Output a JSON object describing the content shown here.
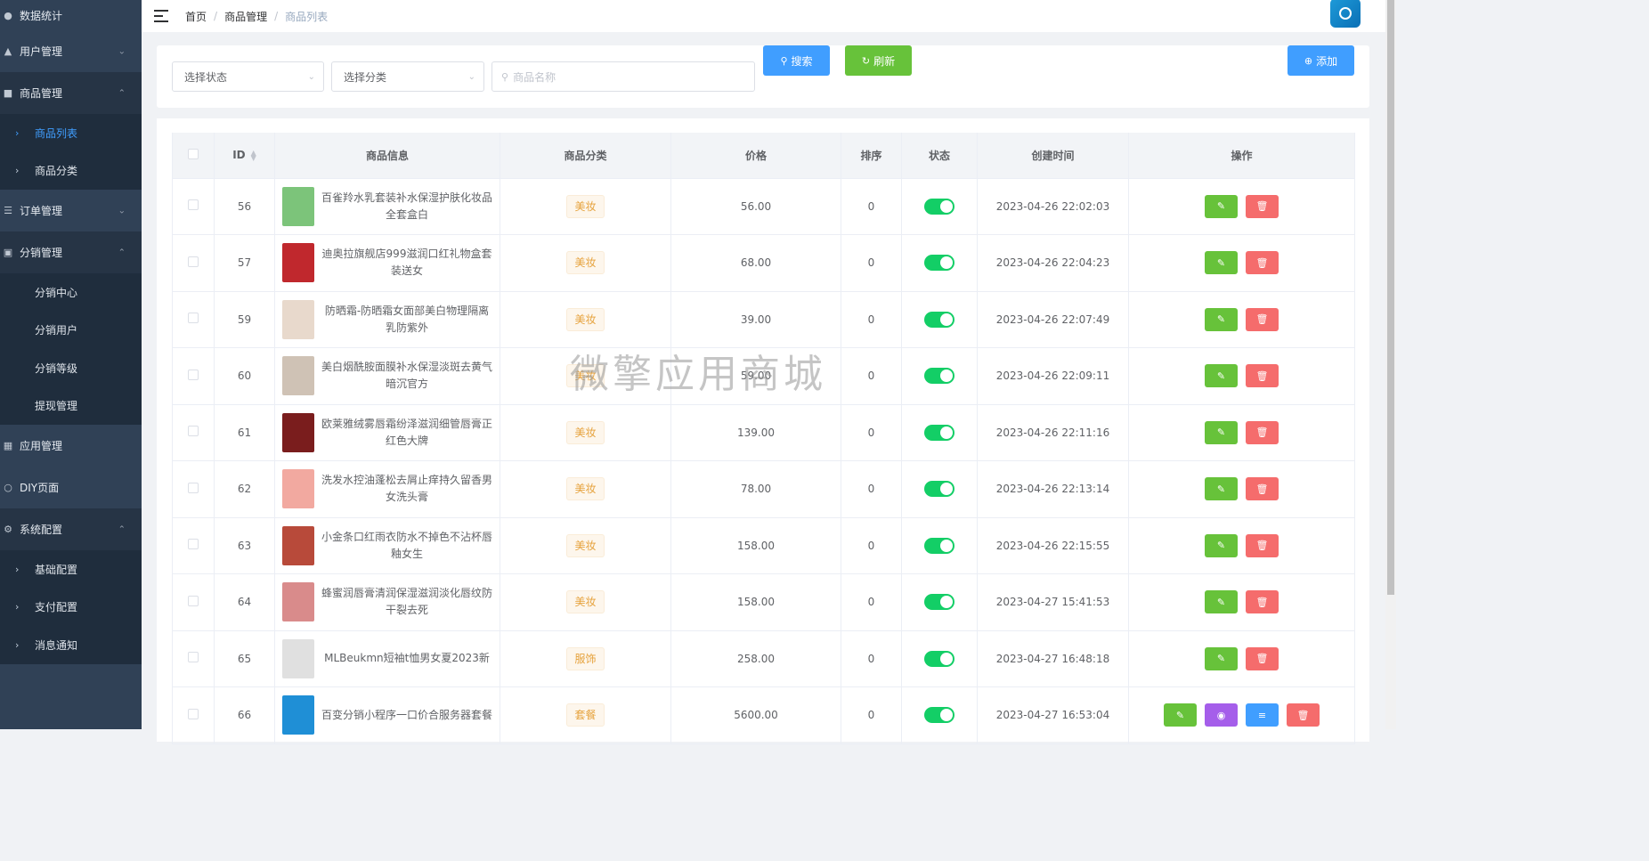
{
  "sidebar": {
    "items": [
      {
        "label": "数据统计",
        "icon": "dashboard-icon"
      },
      {
        "label": "用户管理",
        "icon": "user-icon",
        "arrow": "down"
      },
      {
        "label": "商品管理",
        "icon": "goods-icon",
        "arrow": "up"
      },
      {
        "label": "订单管理",
        "icon": "order-icon",
        "arrow": "down"
      },
      {
        "label": "分销管理",
        "icon": "distribution-icon",
        "arrow": "up"
      },
      {
        "label": "应用管理",
        "icon": "apps-icon"
      },
      {
        "label": "DIY页面",
        "icon": "diy-icon"
      },
      {
        "label": "系统配置",
        "icon": "settings-icon",
        "arrow": "up"
      }
    ],
    "goods_sub": [
      "商品列表",
      "商品分类"
    ],
    "distribution_sub": [
      "分销中心",
      "分销用户",
      "分销等级",
      "提现管理"
    ],
    "settings_sub": [
      "基础配置",
      "支付配置",
      "消息通知"
    ]
  },
  "breadcrumb": [
    "首页",
    "商品管理",
    "商品列表"
  ],
  "filters": {
    "status_placeholder": "选择状态",
    "category_placeholder": "选择分类",
    "name_placeholder": "商品名称",
    "search_label": "搜索",
    "refresh_label": "刷新",
    "add_label": "添加"
  },
  "table": {
    "headers": [
      "ID",
      "商品信息",
      "商品分类",
      "价格",
      "排序",
      "状态",
      "创建时间",
      "操作"
    ],
    "rows": [
      {
        "id": "56",
        "name": "百雀羚水乳套装补水保湿护肤化妆品全套盒白",
        "category": "美妆",
        "price": "56.00",
        "sort": "0",
        "created": "2023-04-26 22:02:03",
        "thumb": "#7cc47a"
      },
      {
        "id": "57",
        "name": "迪奥拉旗舰店999滋润口红礼物盒套装送女",
        "category": "美妆",
        "price": "68.00",
        "sort": "0",
        "created": "2023-04-26 22:04:23",
        "thumb": "#c0282d"
      },
      {
        "id": "59",
        "name": "防晒霜-防晒霜女面部美白物理隔离乳防紫外",
        "category": "美妆",
        "price": "39.00",
        "sort": "0",
        "created": "2023-04-26 22:07:49",
        "thumb": "#e8d9cc"
      },
      {
        "id": "60",
        "name": "美白烟酰胺面膜补水保湿淡斑去黄气暗沉官方",
        "category": "美妆",
        "price": "59.00",
        "sort": "0",
        "created": "2023-04-26 22:09:11",
        "thumb": "#cfc2b5"
      },
      {
        "id": "61",
        "name": "欧莱雅绒雾唇霜纷泽滋润细管唇膏正红色大牌",
        "category": "美妆",
        "price": "139.00",
        "sort": "0",
        "created": "2023-04-26 22:11:16",
        "thumb": "#7a1d1d"
      },
      {
        "id": "62",
        "name": "洗发水控油蓬松去屑止痒持久留香男女洗头膏",
        "category": "美妆",
        "price": "78.00",
        "sort": "0",
        "created": "2023-04-26 22:13:14",
        "thumb": "#f2a9a0"
      },
      {
        "id": "63",
        "name": "小金条口红雨衣防水不掉色不沾杯唇釉女生",
        "category": "美妆",
        "price": "158.00",
        "sort": "0",
        "created": "2023-04-26 22:15:55",
        "thumb": "#b84a3a"
      },
      {
        "id": "64",
        "name": "蜂蜜润唇膏清润保湿滋润淡化唇纹防干裂去死",
        "category": "美妆",
        "price": "158.00",
        "sort": "0",
        "created": "2023-04-27 15:41:53",
        "thumb": "#d98b8b"
      },
      {
        "id": "65",
        "name": "MLBeukmn短袖t恤男女夏2023新",
        "category": "服饰",
        "price": "258.00",
        "sort": "0",
        "created": "2023-04-27 16:48:18",
        "thumb": "#e0e0e0"
      },
      {
        "id": "66",
        "name": "百变分销小程序一口价合服务器套餐",
        "category": "套餐",
        "price": "5600.00",
        "sort": "0",
        "created": "2023-04-27 16:53:04",
        "thumb": "#1f8fd6",
        "extra_ops": true
      }
    ]
  },
  "watermark": "微擎应用商城",
  "colors": {
    "sidebar": "#304156",
    "primary": "#409eff",
    "success": "#67c23a",
    "danger": "#f56c6c",
    "switch_on": "#13ce66"
  }
}
